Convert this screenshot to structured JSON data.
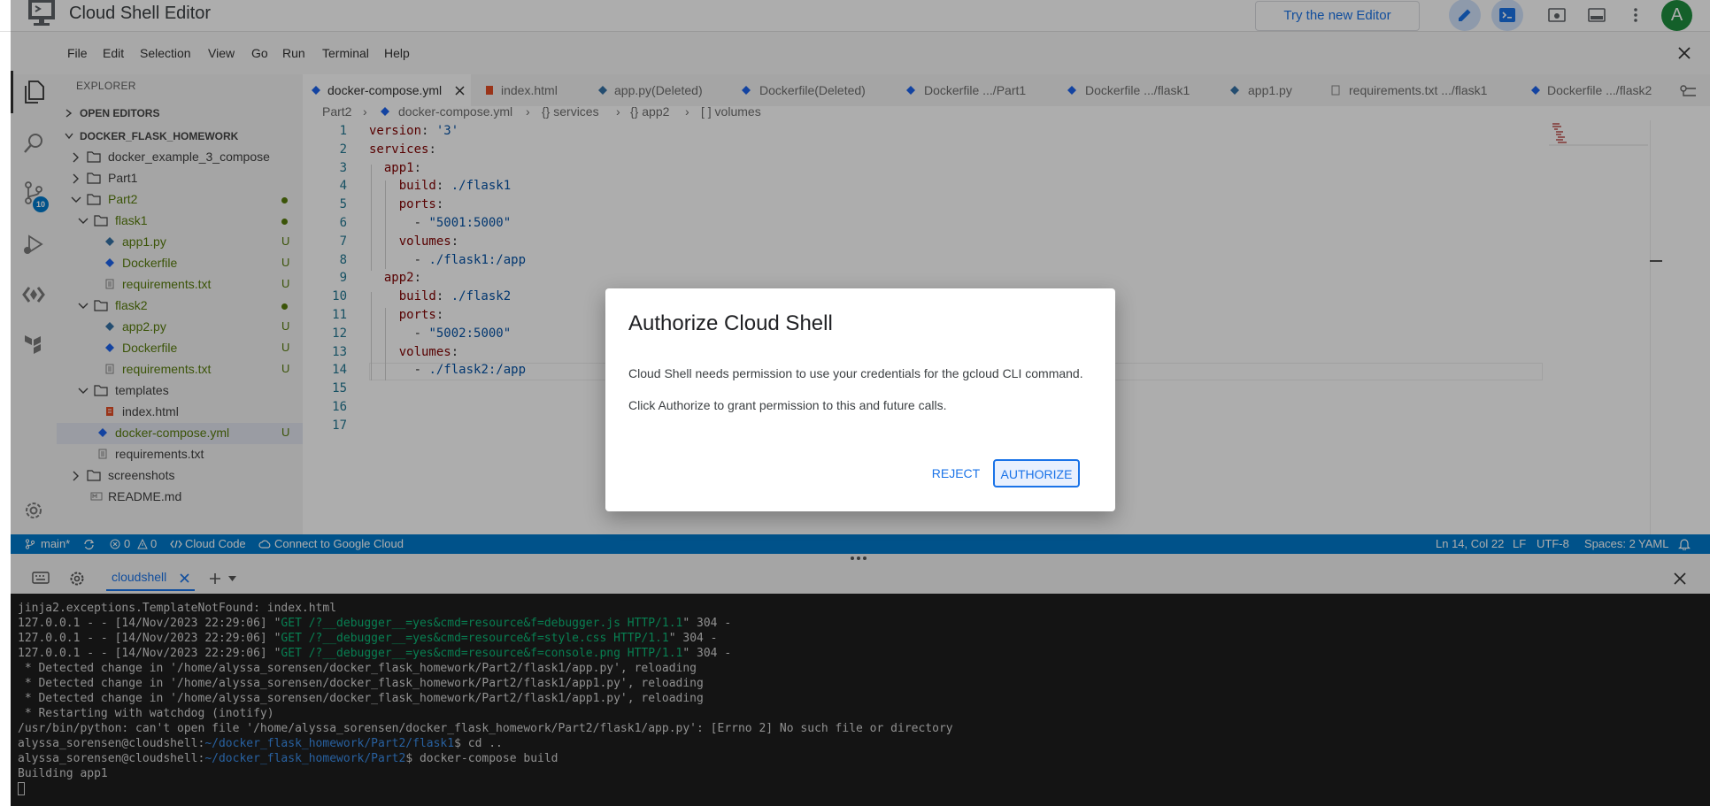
{
  "app": {
    "title": "Cloud Shell Editor",
    "try_new_label": "Try the new Editor",
    "avatar_letter": "A"
  },
  "menu": [
    "File",
    "Edit",
    "Selection",
    "View",
    "Go",
    "Run",
    "Terminal",
    "Help"
  ],
  "explorer": {
    "title": "EXPLORER",
    "open_editors": "OPEN EDITORS",
    "root": "DOCKER_FLASK_HOMEWORK",
    "tree": [
      {
        "label": "docker_example_3_compose"
      },
      {
        "label": "Part1"
      },
      {
        "label": "Part2"
      },
      {
        "label": "flask1"
      },
      {
        "label": "app1.py",
        "status": "U"
      },
      {
        "label": "Dockerfile",
        "status": "U"
      },
      {
        "label": "requirements.txt",
        "status": "U"
      },
      {
        "label": "flask2"
      },
      {
        "label": "app2.py",
        "status": "U"
      },
      {
        "label": "Dockerfile",
        "status": "U"
      },
      {
        "label": "requirements.txt",
        "status": "U"
      },
      {
        "label": "templates"
      },
      {
        "label": "index.html"
      },
      {
        "label": "docker-compose.yml",
        "status": "U"
      },
      {
        "label": "requirements.txt"
      },
      {
        "label": "screenshots"
      },
      {
        "label": "README.md"
      }
    ]
  },
  "source_control_badge": "10",
  "tabs": [
    {
      "label": "docker-compose.yml"
    },
    {
      "label": "index.html"
    },
    {
      "label": "app.py(Deleted)"
    },
    {
      "label": "Dockerfile(Deleted)"
    },
    {
      "label": "Dockerfile .../Part1"
    },
    {
      "label": "Dockerfile .../flask1"
    },
    {
      "label": "app1.py"
    },
    {
      "label": "requirements.txt .../flask1"
    },
    {
      "label": "Dockerfile .../flask2"
    }
  ],
  "breadcrumb": [
    "Part2",
    "docker-compose.yml",
    "{} services",
    "{} app2",
    "[ ] volumes"
  ],
  "editor": {
    "line_numbers": [
      "1",
      "2",
      "3",
      "4",
      "5",
      "6",
      "7",
      "8",
      "9",
      "10",
      "11",
      "12",
      "13",
      "14",
      "15",
      "16",
      "17"
    ],
    "lines": [
      [
        {
          "t": "version",
          "c": "k"
        },
        {
          "t": ": ",
          "c": ""
        },
        {
          "t": "'3'",
          "c": "s"
        }
      ],
      [
        {
          "t": "services",
          "c": "k"
        },
        {
          "t": ":",
          "c": ""
        }
      ],
      [
        {
          "t": "  app1",
          "c": "k"
        },
        {
          "t": ":",
          "c": ""
        }
      ],
      [
        {
          "t": "    build",
          "c": "k"
        },
        {
          "t": ": ",
          "c": ""
        },
        {
          "t": "./flask1",
          "c": "s"
        }
      ],
      [
        {
          "t": "    ports",
          "c": "k"
        },
        {
          "t": ":",
          "c": ""
        }
      ],
      [
        {
          "t": "      - ",
          "c": ""
        },
        {
          "t": "\"5001:5000\"",
          "c": "s"
        }
      ],
      [
        {
          "t": "    volumes",
          "c": "k"
        },
        {
          "t": ":",
          "c": ""
        }
      ],
      [
        {
          "t": "      - ",
          "c": ""
        },
        {
          "t": "./flask1:/app",
          "c": "s"
        }
      ],
      [
        {
          "t": "  app2",
          "c": "k"
        },
        {
          "t": ":",
          "c": ""
        }
      ],
      [
        {
          "t": "    build",
          "c": "k"
        },
        {
          "t": ": ",
          "c": ""
        },
        {
          "t": "./flask2",
          "c": "s"
        }
      ],
      [
        {
          "t": "    ports",
          "c": "k"
        },
        {
          "t": ":",
          "c": ""
        }
      ],
      [
        {
          "t": "      - ",
          "c": ""
        },
        {
          "t": "\"5002:5000\"",
          "c": "s"
        }
      ],
      [
        {
          "t": "    volumes",
          "c": "k"
        },
        {
          "t": ":",
          "c": ""
        }
      ],
      [
        {
          "t": "      - ",
          "c": ""
        },
        {
          "t": "./flask2:/app",
          "c": "s"
        }
      ],
      [],
      [],
      []
    ]
  },
  "dialog": {
    "title": "Authorize Cloud Shell",
    "line1": "Cloud Shell needs permission to use your credentials for the gcloud CLI command.",
    "line2": "Click Authorize to grant permission to this and future calls.",
    "reject": "REJECT",
    "authorize": "AUTHORIZE"
  },
  "status": {
    "branch": "main*",
    "problems": "0",
    "warnings": "0",
    "cloud_code": "Cloud Code",
    "connect": "Connect to Google Cloud",
    "position": "Ln 14, Col 22",
    "eol": "LF",
    "encoding": "UTF-8",
    "spaces": "Spaces: 2",
    "language": "YAML"
  },
  "panel": {
    "tab": "cloudshell"
  },
  "terminal": {
    "lines": [
      [
        {
          "t": "jinja2.exceptions.TemplateNotFound: index.html",
          "c": ""
        }
      ],
      [
        {
          "t": "127.0.0.1 - - [14/Nov/2023 22:29:06] \"",
          "c": ""
        },
        {
          "t": "GET /?__debugger__=yes&cmd=resource&f=debugger.js HTTP/1.1",
          "c": "tgreen"
        },
        {
          "t": "\" 304 -",
          "c": ""
        }
      ],
      [
        {
          "t": "127.0.0.1 - - [14/Nov/2023 22:29:06] \"",
          "c": ""
        },
        {
          "t": "GET /?__debugger__=yes&cmd=resource&f=style.css HTTP/1.1",
          "c": "tgreen"
        },
        {
          "t": "\" 304 -",
          "c": ""
        }
      ],
      [
        {
          "t": "127.0.0.1 - - [14/Nov/2023 22:29:06] \"",
          "c": ""
        },
        {
          "t": "GET /?__debugger__=yes&cmd=resource&f=console.png HTTP/1.1",
          "c": "tgreen"
        },
        {
          "t": "\" 304 -",
          "c": ""
        }
      ],
      [
        {
          "t": " * Detected change in '/home/alyssa_sorensen/docker_flask_homework/Part2/flask1/app.py', reloading",
          "c": ""
        }
      ],
      [
        {
          "t": " * Detected change in '/home/alyssa_sorensen/docker_flask_homework/Part2/flask1/app1.py', reloading",
          "c": ""
        }
      ],
      [
        {
          "t": " * Detected change in '/home/alyssa_sorensen/docker_flask_homework/Part2/flask1/app1.py', reloading",
          "c": ""
        }
      ],
      [
        {
          "t": " * Restarting with watchdog (inotify)",
          "c": ""
        }
      ],
      [
        {
          "t": "/usr/bin/python: can't open file '/home/alyssa_sorensen/docker_flask_homework/Part2/flask1/app.py': [Errno 2] No such file or directory",
          "c": ""
        }
      ],
      [
        {
          "t": "alyssa_sorensen@cloudshell:",
          "c": ""
        },
        {
          "t": "~/docker_flask_homework/Part2/flask1",
          "c": "tblue"
        },
        {
          "t": "$ cd ..",
          "c": ""
        }
      ],
      [
        {
          "t": "alyssa_sorensen@cloudshell:",
          "c": ""
        },
        {
          "t": "~/docker_flask_homework/Part2",
          "c": "tblue"
        },
        {
          "t": "$ docker-compose build",
          "c": ""
        }
      ],
      [
        {
          "t": "Building app1",
          "c": ""
        }
      ]
    ]
  }
}
